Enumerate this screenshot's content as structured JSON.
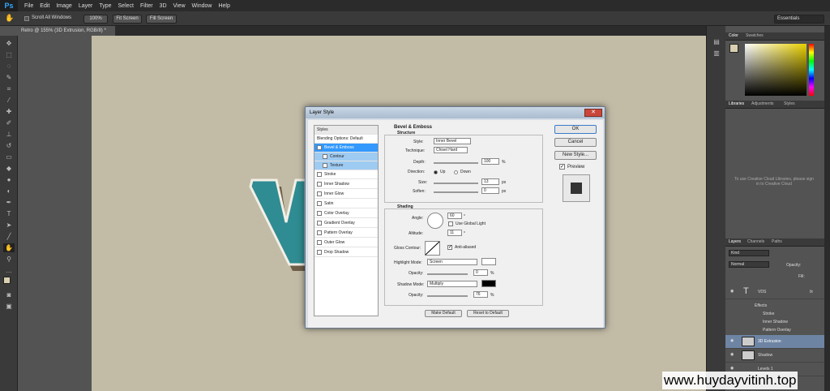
{
  "app": {
    "logo": "Ps",
    "menu": [
      "File",
      "Edit",
      "Image",
      "Layer",
      "Type",
      "Select",
      "Filter",
      "3D",
      "View",
      "Window",
      "Help"
    ]
  },
  "options": {
    "scroll_all_windows": "Scroll All Windows",
    "zoom_100": "100%",
    "fit_screen": "Fit Screen",
    "fill_screen": "Fill Screen",
    "workspace": "Essentials"
  },
  "document": {
    "tab": "Retro @ 155% (3D Extrusion, RGB/8) *"
  },
  "dialog": {
    "title": "Layer Style",
    "close": "✕",
    "styles_header": "Styles",
    "blending": "Blending Options: Default",
    "items": [
      "Bevel & Emboss",
      "Contour",
      "Texture",
      "Stroke",
      "Inner Shadow",
      "Inner Glow",
      "Satin",
      "Color Overlay",
      "Gradient Overlay",
      "Pattern Overlay",
      "Outer Glow",
      "Drop Shadow"
    ],
    "bevel": {
      "heading": "Bevel & Emboss",
      "structure": "Structure",
      "style_label": "Style:",
      "style": "Inner Bevel",
      "technique_label": "Technique:",
      "technique": "Chisel Hard",
      "depth_label": "Depth:",
      "depth": "100",
      "pct": "%",
      "direction_label": "Direction:",
      "up": "Up",
      "down": "Down",
      "size_label": "Size:",
      "size": "13",
      "px": "px",
      "soften_label": "Soften:",
      "soften": "0"
    },
    "shading": {
      "heading": "Shading",
      "angle_label": "Angle:",
      "angle": "60",
      "deg": "°",
      "global_light": "Use Global Light",
      "altitude_label": "Altitude:",
      "altitude": "11",
      "gloss_label": "Gloss Contour:",
      "anti_aliased": "Anti-aliased",
      "highlight_label": "Highlight Mode:",
      "highlight_mode": "Screen",
      "opacity_label": "Opacity:",
      "highlight_opacity": "0",
      "shadow_label": "Shadow Mode:",
      "shadow_mode": "Multiply",
      "shadow_opacity": "76",
      "highlight_color": "#ffffff",
      "shadow_color": "#000000"
    },
    "make_default": "Make Default",
    "reset_default": "Reset to Default",
    "ok": "OK",
    "cancel": "Cancel",
    "new_style": "New Style...",
    "preview": "Preview"
  },
  "panels": {
    "color_tabs": [
      "Color",
      "Swatches"
    ],
    "lib_tabs": [
      "Libraries",
      "Adjustments",
      "Styles"
    ],
    "lib_msg": "To use Creative Cloud Libraries, please sign in to Creative Cloud",
    "layer_tabs": [
      "Layers",
      "Channels",
      "Paths"
    ],
    "kind": "Kind",
    "blend": "Normal",
    "opacity_label": "Opacity:",
    "fill_label": "Fill:",
    "layers": [
      {
        "name": "VDS",
        "fx": "fx"
      },
      {
        "name": "Effects"
      },
      {
        "name": "Stroke"
      },
      {
        "name": "Inner Shadow"
      },
      {
        "name": "Pattern Overlay"
      },
      {
        "name": "3D Extrusion"
      },
      {
        "name": "Shadow"
      },
      {
        "name": "Levels 1"
      }
    ]
  },
  "watermark": "www.huydayvitinh.top"
}
